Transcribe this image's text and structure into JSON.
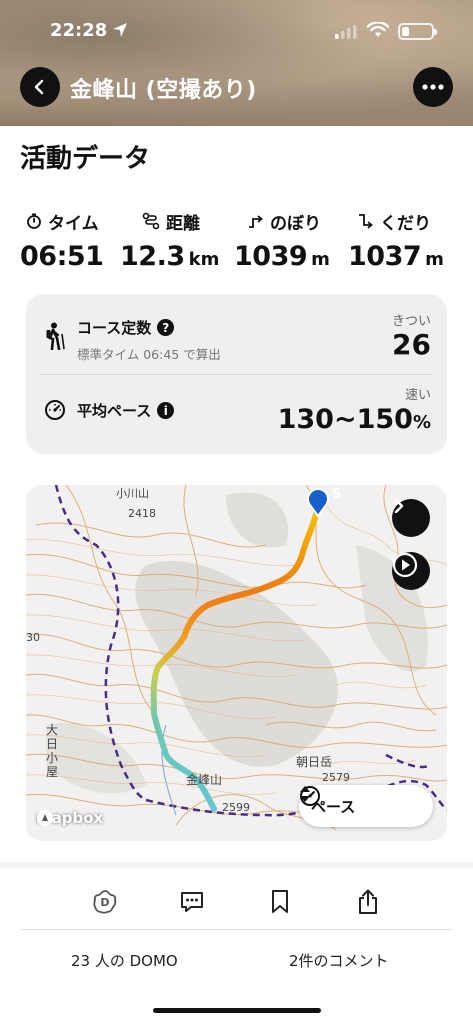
{
  "status_bar": {
    "time": "22:28"
  },
  "header": {
    "title": "金峰山 (空撮あり)"
  },
  "section_title": "活動データ",
  "stats": [
    {
      "label": "タイム",
      "value": "06:51",
      "unit": ""
    },
    {
      "label": "距離",
      "value": "12.3",
      "unit": "km"
    },
    {
      "label": "のぼり",
      "value": "1039",
      "unit": "m"
    },
    {
      "label": "くだり",
      "value": "1037",
      "unit": "m"
    }
  ],
  "course": {
    "title": "コース定数",
    "subtitle": "標準タイム 06:45 で算出",
    "tag": "きつい",
    "value": "26"
  },
  "pace": {
    "title": "平均ペース",
    "tag": "速い",
    "value": "130~150",
    "unit": "%"
  },
  "map": {
    "labels": {
      "peak_name": "小川山",
      "elev_2418": "2418",
      "num_30": "30",
      "hut": "大日小屋",
      "asahidake": "朝日岳",
      "elev_2579": "2579",
      "kinpu": "金峰山",
      "elev_2599": "2599"
    },
    "start_marker": "S",
    "pace_button": "ペース",
    "attribution": "mapbox"
  },
  "footer": {
    "domo": "23 人の DOMO",
    "comments": "2件のコメント"
  }
}
